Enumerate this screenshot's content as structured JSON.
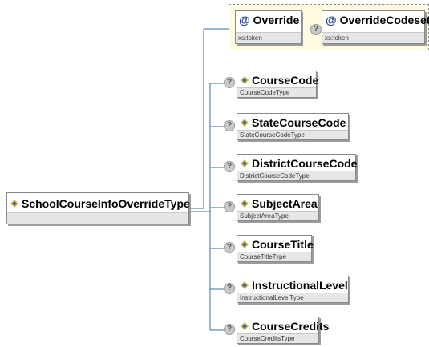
{
  "root": {
    "name": "SchoolCourseInfoOverrideType",
    "icon": "element-diamond-icon"
  },
  "attributes": [
    {
      "name": "Override",
      "type": "xs:token",
      "icon": "at-attribute-icon",
      "optional_marker": ""
    },
    {
      "name": "OverrideCodeset",
      "type": "xs:token",
      "icon": "at-attribute-icon",
      "optional_marker": "?"
    }
  ],
  "elements": [
    {
      "name": "CourseCode",
      "type": "CourseCodeType",
      "optional_marker": "?"
    },
    {
      "name": "StateCourseCode",
      "type": "StateCourseCodeType",
      "optional_marker": "?"
    },
    {
      "name": "DistrictCourseCode",
      "type": "DistrictCourseCodeType",
      "optional_marker": "?"
    },
    {
      "name": "SubjectArea",
      "type": "SubjectAreaType",
      "optional_marker": "?"
    },
    {
      "name": "CourseTitle",
      "type": "CourseTitleType",
      "optional_marker": "?"
    },
    {
      "name": "InstructionalLevel",
      "type": "InstructionalLevelType",
      "optional_marker": "?"
    },
    {
      "name": "CourseCredits",
      "type": "CourseCreditsType",
      "optional_marker": "?"
    }
  ],
  "colors": {
    "connector": "#3a6ea5",
    "attr_group_bg": "#fefbe0",
    "type_band": "#e6e6e6"
  }
}
